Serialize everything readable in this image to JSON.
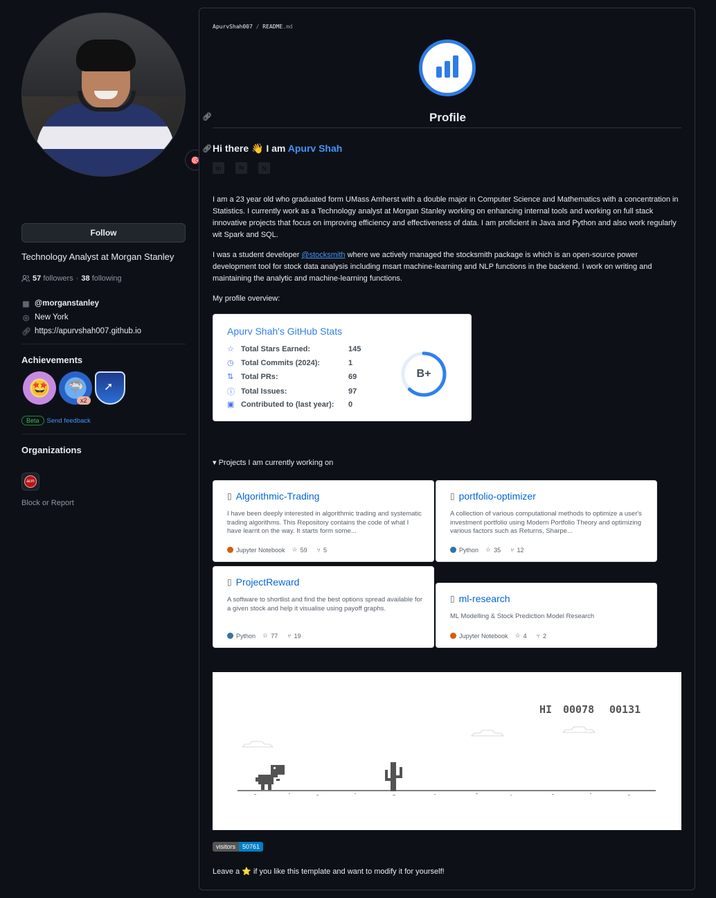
{
  "sidebar": {
    "status_emoji": "🎯",
    "follow_label": "Follow",
    "bio": "Technology Analyst at Morgan Stanley",
    "followers_count": "57",
    "followers_label": "followers",
    "following_count": "38",
    "following_label": "following",
    "separator": "·",
    "company": "@morganstanley",
    "location": "New York",
    "website": "https://apurvshah007.github.io",
    "achievements_title": "Achievements",
    "achievement_multiplier": "x2",
    "beta_label": "Beta",
    "feedback_label": "Send feedback",
    "organizations_title": "Organizations",
    "org_label": "acm",
    "block_label": "Block or Report"
  },
  "readme": {
    "breadcrumb_user": "ApurvShah007",
    "breadcrumb_sep": " / ",
    "breadcrumb_file": "README",
    "breadcrumb_ext": ".md",
    "profile_heading": "Profile",
    "greeting_prefix": "Hi there",
    "greeting_wave": "👋",
    "greeting_iam": "I am",
    "greeting_name": "Apurv Shah",
    "social_icons": [
      "linkedin-icon",
      "freecodecamp-icon",
      "notion-icon"
    ],
    "social_glyphs": [
      "in",
      "⇋",
      "N"
    ],
    "para1": "I am a 23 year old who graduated form UMass Amherst with a double major in Computer Science and Mathematics with a concentration in Statistics. I currently work as a Technology analyst at Morgan Stanley working on enhancing internal tools and working on full stack innovative projects that focus on improving efficiency and effectiveness of data. I am proficient in Java and Python and also work regularly wit Spark and SQL.",
    "para2_prefix": "I was a student developer ",
    "para2_link": "@stocksmith",
    "para2_suffix": " where we actively managed the stocksmith package is which is an open-source power development tool for stock data analysis including msart machine-learning and NLP functions in the backend. I work on writing and maintaining the analytic and machine-learning functions.",
    "overview_label": "My profile overview:",
    "summary_label": "▾ Projects I am currently working on",
    "visitors_label": "visitors",
    "visitors_count": "50761",
    "leave_prefix": "Leave a",
    "leave_star": "⭐",
    "leave_suffix": "if you like this template and want to modify it for yourself!"
  },
  "stats": {
    "title": "Apurv Shah's GitHub Stats",
    "rows": [
      {
        "label": "Total Stars Earned:",
        "value": "145",
        "icon": "star-icon",
        "glyph": "☆"
      },
      {
        "label": "Total Commits (2024):",
        "value": "1",
        "icon": "history-icon",
        "glyph": "◷"
      },
      {
        "label": "Total PRs:",
        "value": "69",
        "icon": "pull-request-icon",
        "glyph": "⇅"
      },
      {
        "label": "Total Issues:",
        "value": "97",
        "icon": "issue-icon",
        "glyph": "ⓘ"
      },
      {
        "label": "Contributed to (last year):",
        "value": "0",
        "icon": "repo-icon",
        "glyph": "▣"
      }
    ],
    "grade": "B+",
    "grade_progress": 0.62,
    "ring_color": "#2f80ed"
  },
  "repos": [
    {
      "name": "Algorithmic-Trading",
      "desc": "I have been deeply interested in algorithmic trading and systematic trading algorithms. This Repository contains the code of what I have learnt on the way. It starts form some...",
      "lang": "Jupyter Notebook",
      "lang_color": "#DA5B0B",
      "stars": "59",
      "forks": "5"
    },
    {
      "name": "portfolio-optimizer",
      "desc": "A collection of various computational methods to optimize a user's investment portfolio using Modern Portfolio Theory and optimizing various factors such as Returns, Sharpe...",
      "lang": "Python",
      "lang_color": "#3572A5",
      "stars": "35",
      "forks": "12"
    },
    {
      "name": "ProjectReward",
      "desc": "A software to shortlist and find the best options spread available for a given stock and help it visualise using payoff graphs.",
      "lang": "Python",
      "lang_color": "#3572A5",
      "stars": "77",
      "forks": "19"
    },
    {
      "name": "ml-research",
      "desc": "ML Modelling & Stock Prediction Model Research",
      "lang": "Jupyter Notebook",
      "lang_color": "#DA5B0B",
      "stars": "4",
      "forks": "2"
    }
  ],
  "game": {
    "hi_label": "HI",
    "hi_score": "00078",
    "score": "00131"
  },
  "colors": {
    "accent": "#4493f8",
    "background": "#0d1117",
    "border": "#30363d"
  }
}
